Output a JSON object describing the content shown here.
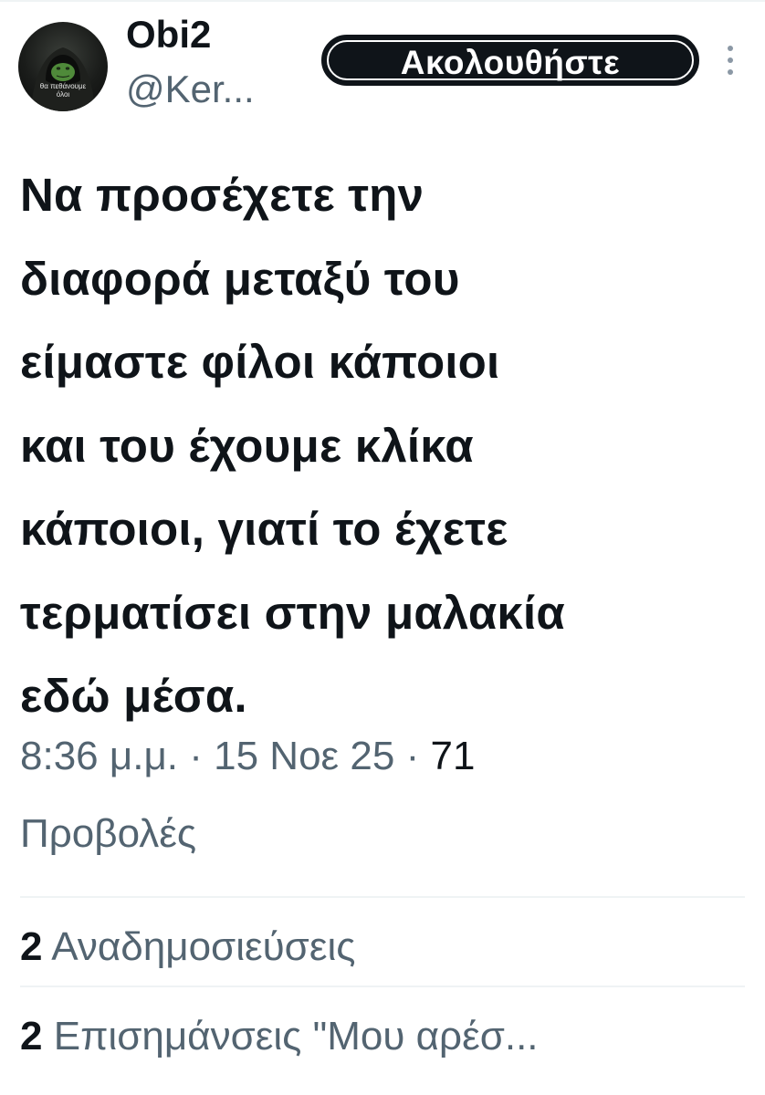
{
  "author": {
    "display_name": "Obi2",
    "handle": "@Ker...",
    "avatar_caption": "θα πεθάνουμε\nόλοι"
  },
  "follow_button": {
    "label": "Ακολουθήστε"
  },
  "tweet": {
    "text": "Να προσέχετε την\nδιαφορά μεταξύ του\nείμαστε φίλοι κάποιοι\nκαι του έχουμε κλίκα\nκάποιοι, γιατί το έχετε\nτερματίσει στην μαλακία\nεδώ μέσα."
  },
  "meta": {
    "time": "8:36 μ.μ.",
    "separator": "·",
    "date": "15 Νοε 25",
    "views_count": "71",
    "views_label": "Προβολές"
  },
  "stats": {
    "reposts": {
      "count": "2",
      "label": "Αναδημοσιεύσεις"
    },
    "likes": {
      "count": "2",
      "label": "Επισημάνσεις \"Μου αρέσ..."
    }
  },
  "colors": {
    "text_primary": "#0f1419",
    "text_secondary": "#536471",
    "divider": "#eff3f4",
    "button_bg": "#0f1419"
  },
  "icons": {
    "more": "more-vertical-icon"
  }
}
